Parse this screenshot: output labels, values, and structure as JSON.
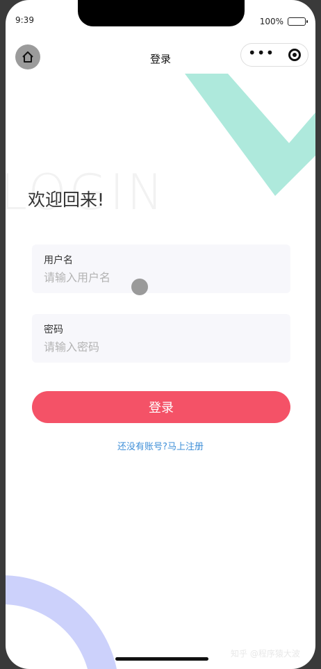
{
  "status_bar": {
    "time": "9:39",
    "battery": "100%"
  },
  "nav": {
    "title": "登录",
    "more_icon": "more-dots-icon",
    "close_icon": "mini-program-close-icon",
    "home_icon": "home-icon"
  },
  "background": {
    "text": "LOGIN"
  },
  "welcome": "欢迎回来!",
  "form": {
    "username_label": "用户名",
    "username_placeholder": "请输入用户名",
    "password_label": "密码",
    "password_placeholder": "请输入密码"
  },
  "login_button": "登录",
  "register_link": "还没有账号?马上注册",
  "watermark": "知乎 @程序猿大波",
  "colors": {
    "accent": "#f45267",
    "link": "#3f8fd8",
    "teal_deco": "#aee9dc",
    "lavender_deco": "#ccd1fb"
  }
}
